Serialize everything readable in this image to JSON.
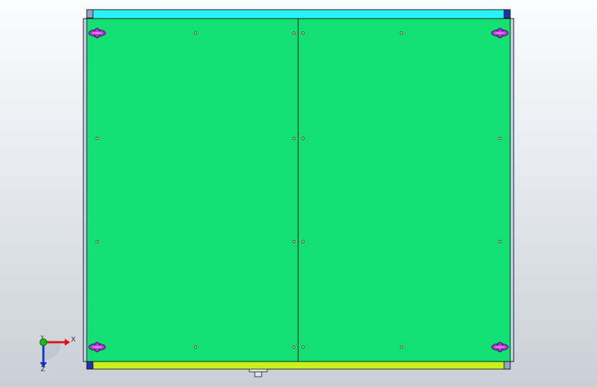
{
  "view": {
    "background_top": "#fbfcfd",
    "background_bottom": "#c9cfd6"
  },
  "model": {
    "panel_color": "#13e073",
    "top_rail_color": "#29f0f5",
    "bottom_rail_color": "#c8f01e",
    "side_rail_color": "#c6d2e8",
    "corner_block_color": "#2233aa",
    "handle_color": "#a23ad0",
    "outline_color": "#1a1a1a"
  },
  "triad": {
    "x_label": "X",
    "y_label": "Y",
    "z_label": "Z",
    "x_color": "#e01010",
    "y_color": "#10c010",
    "z_color": "#1030d0"
  }
}
